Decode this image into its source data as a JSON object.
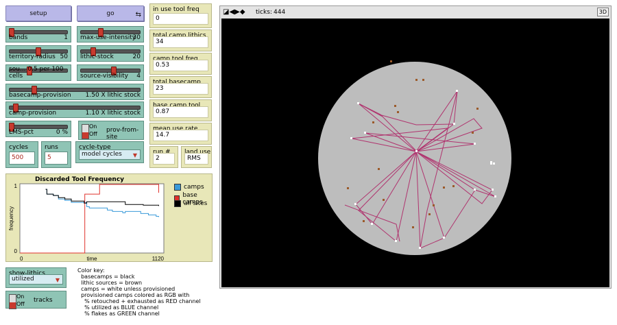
{
  "buttons": {
    "setup": "setup",
    "go": "go",
    "go_forever_icon": "forever-arrows-icon"
  },
  "sliders": {
    "bands": {
      "label": "bands",
      "value": "1",
      "level": 0.0
    },
    "max_use_intensity": {
      "label": "max-use-intensity",
      "value": "30",
      "level": 0.32
    },
    "territory_radius": {
      "label": "territory-radius",
      "value": "50",
      "level": 0.49
    },
    "lithic_stock": {
      "label": "lithic-stock",
      "value": "20",
      "level": 0.18
    },
    "sources": {
      "label": "sou... 0.5 per 100 cells",
      "level": 0.32
    },
    "source_visibility": {
      "label": "source-visibility",
      "value": "4",
      "level": 0.55
    },
    "basecamp_provision": {
      "label": "basecamp-provision",
      "value": "1.50 X lithic stock",
      "level": 0.18
    },
    "camp_provision": {
      "label": "camp-provision",
      "value": "1.10 X lithic stock",
      "level": 0.03
    },
    "lms_pct": {
      "label": "LMS-pct",
      "value": "0 %",
      "level": 0.0
    }
  },
  "switches": {
    "prov_from_site": {
      "on": "On",
      "off": "Off",
      "label": "prov-from-site"
    },
    "tracks": {
      "on": "On",
      "off": "Off",
      "label": "tracks"
    }
  },
  "inputs": {
    "cycles": {
      "label": "cycles",
      "value": "500"
    },
    "runs": {
      "label": "runs",
      "value": "5"
    }
  },
  "choosers": {
    "cycle_type": {
      "label": "cycle-type",
      "value": "model cycles"
    },
    "show_lithics": {
      "label": "show-lithics",
      "value": "utilized"
    }
  },
  "monitors": {
    "in_use_tool_freq": {
      "label": "in use tool freq",
      "value": "0"
    },
    "total_camp_lithics": {
      "label": "total camp lithics",
      "value": "34"
    },
    "camp_tool_freq": {
      "label": "camp tool freq",
      "value": "0.53"
    },
    "total_basecamp_lithics": {
      "label": "total basecamp lithics",
      "value": "23"
    },
    "base_camp_tool_freq": {
      "label": "base camp tool freq",
      "value": "0.87"
    },
    "mean_use_rate": {
      "label": "mean use rate",
      "value": "14.7"
    },
    "run_num": {
      "label": "run #",
      "value": "2"
    },
    "land_use": {
      "label": "land use",
      "value": "RMS"
    }
  },
  "plot": {
    "title": "Discarded Tool Frequency",
    "ylabel": "frequency",
    "xlabel": "time",
    "ymax": "1",
    "ymin": "0",
    "xmin": "0",
    "xmax": "1120",
    "legend": [
      {
        "name": "camps",
        "color": "#3a9ad9"
      },
      {
        "name": "base camps",
        "color": "#e0312b"
      },
      {
        "name": "all sites",
        "color": "#000000"
      }
    ]
  },
  "chart_data": {
    "type": "line",
    "title": "Discarded Tool Frequency",
    "xlabel": "time",
    "ylabel": "frequency",
    "xlim": [
      0,
      1120
    ],
    "ylim": [
      0,
      1
    ],
    "series": [
      {
        "name": "camps",
        "color": "#3a9ad9",
        "x": [
          200,
          210,
          260,
          300,
          350,
          400,
          520,
          540,
          680,
          720,
          780,
          800,
          820,
          940,
          960,
          1000,
          1020,
          1060,
          1080
        ],
        "y": [
          0.92,
          0.85,
          0.83,
          0.78,
          0.76,
          0.73,
          0.67,
          0.65,
          0.62,
          0.6,
          0.6,
          0.58,
          0.6,
          0.57,
          0.57,
          0.55,
          0.55,
          0.53,
          0.52
        ]
      },
      {
        "name": "base camps",
        "color": "#e0312b",
        "x": [
          0,
          500,
          505,
          610,
          620,
          1080
        ],
        "y": [
          0.0,
          0.0,
          0.85,
          0.85,
          0.99,
          0.87
        ]
      },
      {
        "name": "all sites",
        "color": "#000000",
        "x": [
          200,
          210,
          260,
          300,
          350,
          400,
          500,
          520,
          700,
          820,
          960,
          1080
        ],
        "y": [
          0.92,
          0.85,
          0.83,
          0.8,
          0.78,
          0.75,
          0.72,
          0.74,
          0.74,
          0.7,
          0.69,
          0.68
        ]
      }
    ]
  },
  "view": {
    "ticks_label": "ticks:",
    "ticks_value": "444",
    "three_d": "3D"
  },
  "color_key": [
    "Color key:",
    "  basecamps = black",
    "  lithic sources = brown",
    "  camps = white unless provisioned",
    "  provisioned camps colored as RGB with",
    "    % retouched + exhausted as RED channel",
    "    % utilized as BLUE channel",
    "    % flakes as GREEN channel"
  ]
}
